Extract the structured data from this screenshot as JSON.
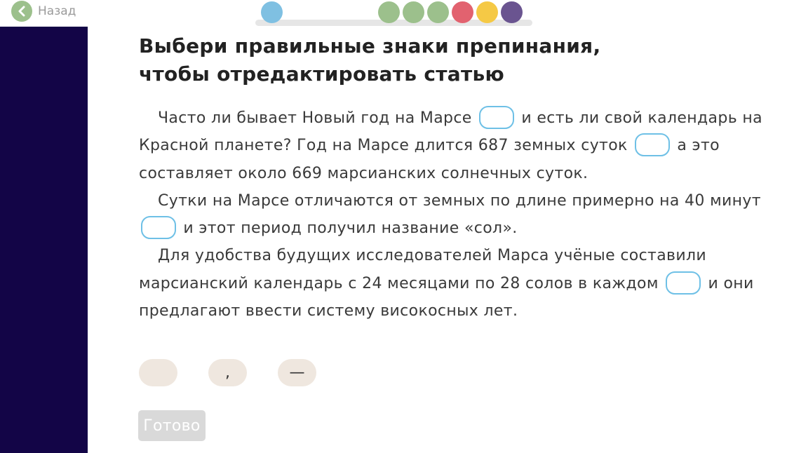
{
  "nav": {
    "back_label": "Назад",
    "back_icon": "chevron-left-icon"
  },
  "progress": {
    "steps": [
      {
        "status": "current",
        "color": "#7fc0e2"
      },
      {
        "status": "correct",
        "color": "#9cc08c"
      },
      {
        "status": "correct",
        "color": "#9cc08c"
      },
      {
        "status": "correct",
        "color": "#9cc08c"
      },
      {
        "status": "wrong",
        "color": "#e2626f"
      },
      {
        "status": "bonus",
        "color": "#f5c945"
      },
      {
        "status": "final",
        "color": "#6a5490"
      }
    ]
  },
  "colors": {
    "sidebar": "#130547",
    "gap_border": "#6ec0e6",
    "option_bg": "#efe7df",
    "done_disabled": "#d9d9d9"
  },
  "task": {
    "title_line1": "Выбери правильные знаки препинания,",
    "title_line2": "чтобы отредактировать статью",
    "p1_a": "Часто ли бывает Новый год на Марсе",
    "p1_b": "и есть ли свой календарь на Красной планете? Год на Марсе длится 687 земных суток",
    "p1_c": "а это составляет около 669 марсианских солнечных суток.",
    "p2_a": "Сутки на Марсе отличаются от земных по длине примерно на 40 минут",
    "p2_b": "и этот период получил название «сол».",
    "p3_a": "Для удобства будущих исследователей Марса учёные составили марсианский календарь с 24 месяцами по 28 солов в каждом",
    "p3_b": "и они предлагают ввести систему високосных лет."
  },
  "options": [
    "",
    ",",
    "—"
  ],
  "done_label": "Готово"
}
